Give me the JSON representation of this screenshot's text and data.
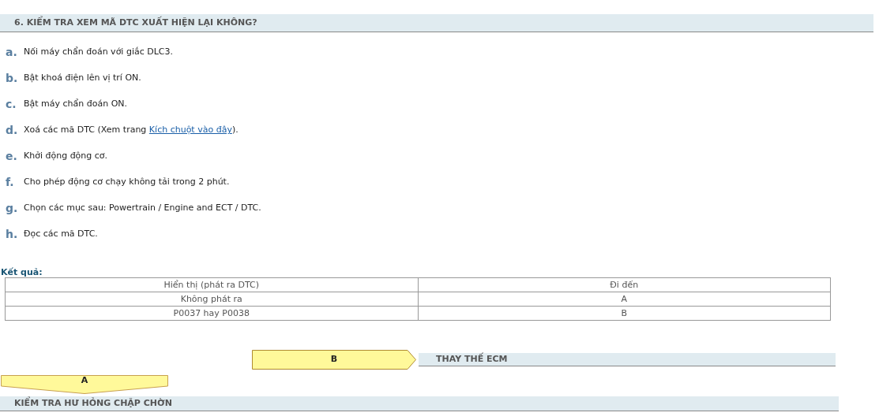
{
  "section_title": "6. KIỂM TRA XEM MÃ DTC XUẤT HIỆN LẠI KHÔNG?",
  "steps": [
    {
      "letter": "a.",
      "text": "Nối máy chẩn đoán với giắc DLC3."
    },
    {
      "letter": "b.",
      "text": "Bật khoá điện lên vị trí ON."
    },
    {
      "letter": "c.",
      "text": "Bật máy chẩn đoán ON."
    },
    {
      "letter": "d.",
      "text": "Xoá các mã DTC (Xem trang ",
      "link": "Kích chuột vào đây",
      "after": ")."
    },
    {
      "letter": "e.",
      "text": "Khởi động động cơ."
    },
    {
      "letter": "f.",
      "text": "Cho phép động cơ chạy không tải trong 2 phút."
    },
    {
      "letter": "g.",
      "text": "Chọn các mục sau: Powertrain / Engine and ECT / DTC."
    },
    {
      "letter": "h.",
      "text": "Đọc các mã DTC."
    }
  ],
  "result": {
    "label": "Kết quả:",
    "columns": [
      "Hiển thị (phát ra DTC)",
      "Đi đến"
    ],
    "rows": [
      [
        "Không phát ra",
        "A"
      ],
      [
        "P0037 hay P0038",
        "B"
      ]
    ]
  },
  "branch_b": {
    "letter": "B",
    "target": "THAY THẾ ECM"
  },
  "branch_a": {
    "letter": "A",
    "target": "KIỂM TRA HƯ HỎNG CHẬP CHỜN"
  }
}
